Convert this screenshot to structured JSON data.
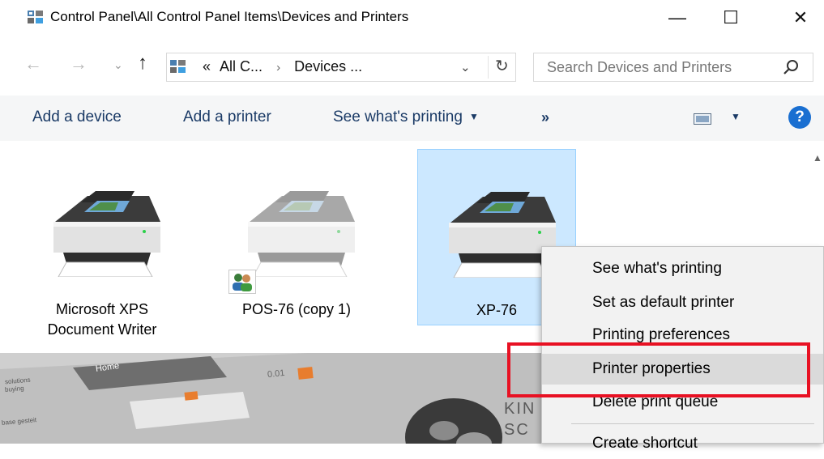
{
  "window": {
    "title": "Control Panel\\All Control Panel Items\\Devices and Printers",
    "minimize": "—",
    "maximize": "☐",
    "close": "✕"
  },
  "address": {
    "back": "←",
    "forward": "→",
    "recent": "⌄",
    "up": "↑",
    "prefix": "«",
    "crumb1": "All C...",
    "separator": "›",
    "crumb2": "Devices ...",
    "dropdown": "⌄",
    "refresh": "↻",
    "search_placeholder": "Search Devices and Printers"
  },
  "commandbar": {
    "add_device": "Add a device",
    "add_printer": "Add a printer",
    "see_printing": "See what's printing",
    "more": "»",
    "help": "?"
  },
  "devices": [
    {
      "name_line1": "Microsoft XPS",
      "name_line2": "Document Writer",
      "state": "normal"
    },
    {
      "name_line1": "POS-76 (copy 1)",
      "state": "offline",
      "shared": true
    },
    {
      "name_line1": "XP-76",
      "state": "selected"
    }
  ],
  "context_menu": {
    "items": [
      {
        "label": "See what's printing"
      },
      {
        "label": "Set as default printer"
      },
      {
        "label": "Printing preferences"
      },
      {
        "label": "Printer properties",
        "highlighted": true
      },
      {
        "label": "Delete print queue"
      },
      {
        "label": "Create shortcut"
      }
    ]
  },
  "photo": {
    "tab_home": "Home",
    "price": "0.01",
    "small_text1": "solutions",
    "small_text2": "buying",
    "small_text3": "base gesteit",
    "brand_partial1": "KIN",
    "brand_partial2": "SC"
  },
  "colors": {
    "accent_link": "#1a3a66",
    "selection": "#cce8ff",
    "highlight_box": "#e81123",
    "help_blue": "#1a6fd1"
  }
}
